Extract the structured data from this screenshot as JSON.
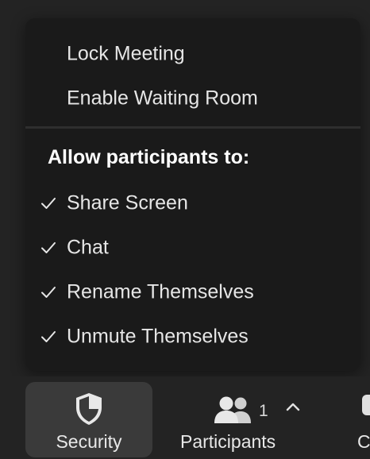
{
  "menu": {
    "top_items": [
      {
        "label": "Lock Meeting"
      },
      {
        "label": "Enable Waiting Room"
      }
    ],
    "section_header": "Allow participants to:",
    "permissions": [
      {
        "label": "Share Screen",
        "checked": true
      },
      {
        "label": "Chat",
        "checked": true
      },
      {
        "label": "Rename Themselves",
        "checked": true
      },
      {
        "label": "Unmute Themselves",
        "checked": true
      }
    ]
  },
  "toolbar": {
    "security_label": "Security",
    "security_icon": "shield-icon",
    "participants_label": "Participants",
    "participants_icon": "participants-icon",
    "participants_count": "1",
    "caret_icon": "chevron-up-icon",
    "partial_label": "C",
    "partial_icon": "chat-icon"
  },
  "colors": {
    "menu_bg": "#1a1a1a",
    "page_bg": "#232323",
    "active_button_bg": "#3a3a3a",
    "text": "#e6e6e6"
  }
}
